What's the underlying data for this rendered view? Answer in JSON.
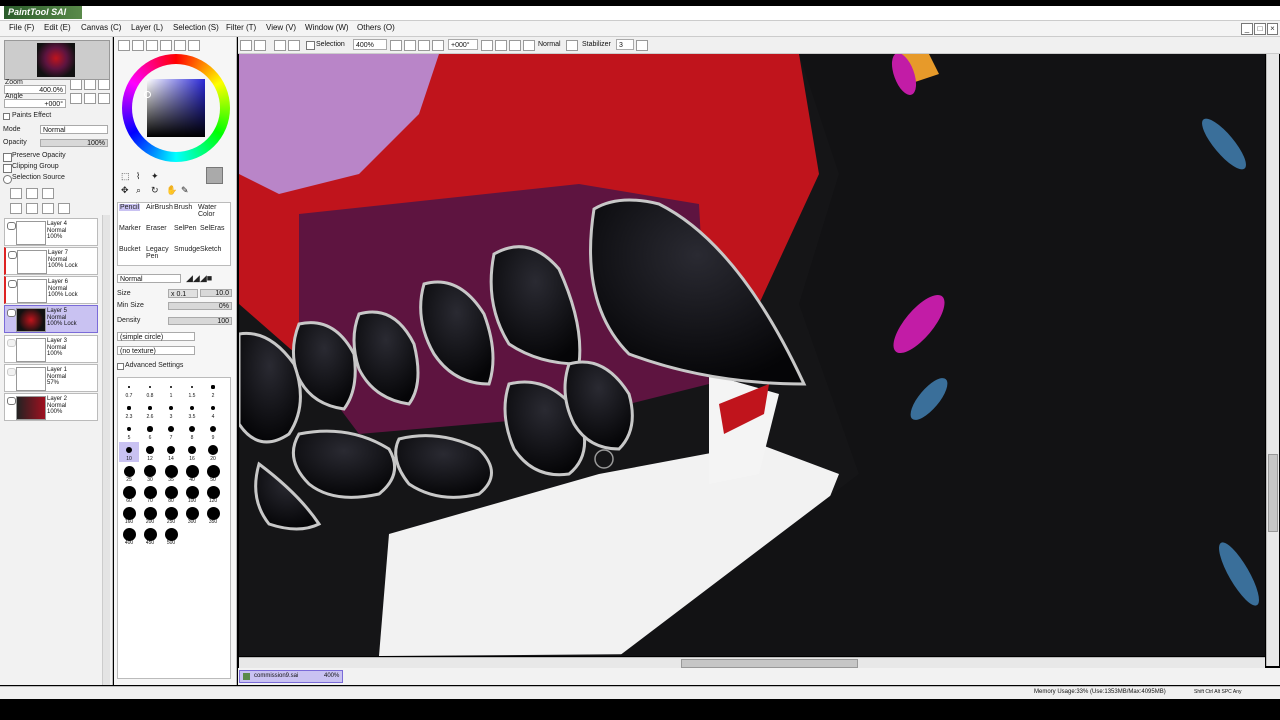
{
  "app": {
    "logo": "PaintTool SAI"
  },
  "menu": {
    "items": [
      "File (F)",
      "Edit (E)",
      "Canvas (C)",
      "Layer (L)",
      "Selection (S)",
      "Filter (T)",
      "View (V)",
      "Window (W)",
      "Others (O)"
    ]
  },
  "toolbar": {
    "selection_label": "Selection",
    "zoom_value": "400%",
    "angle_value": "+000°",
    "blend_mode": "Normal",
    "stabilizer_label": "Stabilizer",
    "stabilizer_value": "3"
  },
  "navigator": {
    "zoom_label": "Zoom",
    "zoom_value": "400.0%",
    "angle_label": "Angle",
    "angle_value": "+000°"
  },
  "layer_props": {
    "paints_effect": "Paints Effect",
    "mode_label": "Mode",
    "mode_value": "Normal",
    "opacity_label": "Opacity",
    "opacity_value": "100%",
    "preserve_opacity": "Preserve Opacity",
    "clipping_group": "Clipping Group",
    "selection_source": "Selection Source"
  },
  "layers": [
    {
      "name": "Layer 4",
      "mode": "Normal",
      "opacity": "100%"
    },
    {
      "name": "Layer 7",
      "mode": "Normal",
      "opacity": "100% Lock"
    },
    {
      "name": "Layer 6",
      "mode": "Normal",
      "opacity": "100% Lock"
    },
    {
      "name": "Layer 5",
      "mode": "Normal",
      "opacity": "100% Lock"
    },
    {
      "name": "Layer 3",
      "mode": "Normal",
      "opacity": "100%"
    },
    {
      "name": "Layer 1",
      "mode": "Normal",
      "opacity": "57%"
    },
    {
      "name": "Layer 2",
      "mode": "Normal",
      "opacity": "100%"
    }
  ],
  "tools": {
    "row1": [
      "Pencil",
      "AirBrush",
      "Brush",
      "Water Color"
    ],
    "row2": [
      "Marker",
      "Eraser",
      "SelPen",
      "SelEras"
    ],
    "row3": [
      "Bucket",
      "Legacy Pen",
      "Smudge",
      "Sketch"
    ]
  },
  "brush": {
    "mode": "Normal",
    "size_label": "Size",
    "size_mult": "x 0.1",
    "size_value": "10.0",
    "min_size_label": "Min Size",
    "min_size_value": "0%",
    "density_label": "Density",
    "density_value": "100",
    "shape": "(simple circle)",
    "texture": "(no texture)",
    "advanced": "Advanced Settings"
  },
  "brush_sizes": [
    "0.7",
    "0.8",
    "1",
    "1.5",
    "2",
    "2.3",
    "2.6",
    "3",
    "3.5",
    "4",
    "5",
    "6",
    "7",
    "8",
    "9",
    "10",
    "12",
    "14",
    "16",
    "20",
    "25",
    "30",
    "35",
    "40",
    "50",
    "60",
    "70",
    "80",
    "100",
    "120",
    "160",
    "200",
    "250",
    "300",
    "350",
    "400",
    "450",
    "500"
  ],
  "file_tab": {
    "name": "commission9.sai",
    "zoom": "400%"
  },
  "status": {
    "memory": "Memory Usage:33% (Use:1353MB/Max:4095MB)",
    "keys": "Shift Ctrl Alt SPC Any"
  },
  "colors": {
    "accent": "#c9c2f2",
    "accent_border": "#7a6bd8",
    "canvas_red": "#c0141c",
    "canvas_purple": "#5e1440"
  }
}
